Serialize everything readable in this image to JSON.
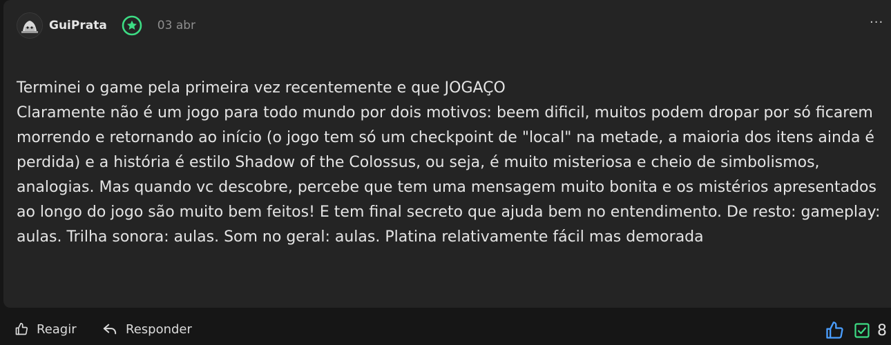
{
  "comment": {
    "author": "GuiPrata",
    "date": "03 abr",
    "badge_icon": "star-icon",
    "more_label": "···",
    "text": "Terminei o game pela primeira vez recentemente e que JOGAÇO\nClaramente não é um jogo para todo mundo por dois motivos: beem dificil, muitos podem dropar por só ficarem morrendo e retornando ao início (o jogo tem só um checkpoint de \"local\" na metade, a maioria dos itens ainda é perdida) e a história é estilo Shadow of the Colossus, ou seja, é muito misteriosa e cheio de simbolismos, analogias. Mas quando vc descobre, percebe que tem uma mensagem muito bonita e os mistérios apresentados ao longo do jogo são muito bem feitos! E tem final secreto que ajuda bem no entendimento. De resto: gameplay: aulas. Trilha sonora: aulas. Som no geral: aulas. Platina relativamente fácil mas demorada"
  },
  "actions": {
    "react_label": "Reagir",
    "reply_label": "Responder",
    "like_count": "8"
  },
  "colors": {
    "card_bg": "#242424",
    "page_bg": "#161616",
    "badge_green": "#3ddc84",
    "like_blue": "#4a9eff",
    "check_green": "#3ddc84"
  }
}
